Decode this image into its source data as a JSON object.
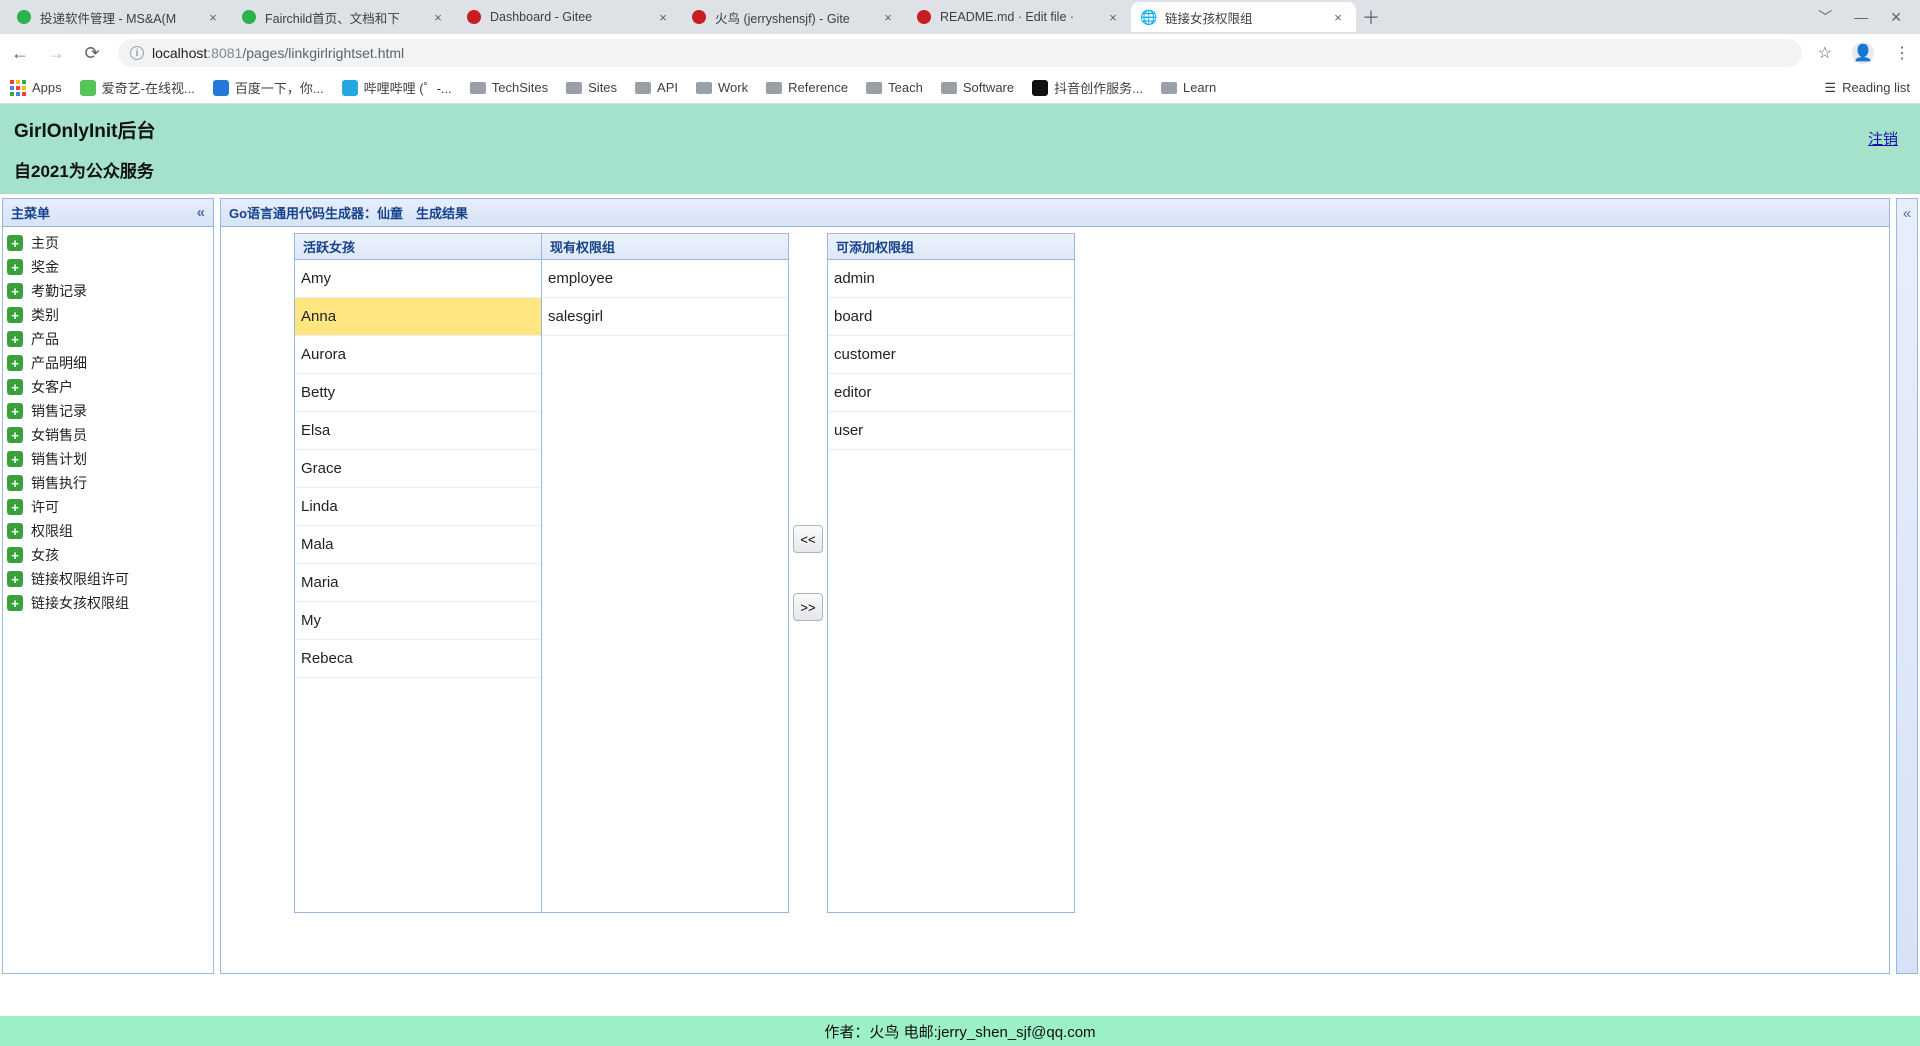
{
  "browser": {
    "tabs": [
      {
        "title": "投递软件管理 - MS&A(M",
        "favicon_color": "#2bb24c"
      },
      {
        "title": "Fairchild首页、文档和下",
        "favicon_color": "#2bb24c"
      },
      {
        "title": "Dashboard - Gitee",
        "favicon_color": "#c71d23"
      },
      {
        "title": "火鸟 (jerryshensjf) - Gite",
        "favicon_color": "#c71d23"
      },
      {
        "title": "README.md · Edit file · ",
        "favicon_color": "#c71d23"
      },
      {
        "title": "链接女孩权限组",
        "favicon_color": "#888888",
        "active": true
      }
    ],
    "url_host": "localhost",
    "url_port": ":8081",
    "url_path": "/pages/linkgirlrightset.html",
    "bookmarks": {
      "apps": "Apps",
      "items": [
        {
          "label": "爱奇艺-在线视...",
          "color": "#55c355"
        },
        {
          "label": "百度一下，你...",
          "color": "#2678d9"
        },
        {
          "label": "哔哩哔哩 (゜-...",
          "color": "#23a8e2"
        }
      ],
      "folders": [
        "TechSites",
        "Sites",
        "API",
        "Work",
        "Reference",
        "Teach",
        "Software"
      ],
      "after_folders": [
        {
          "label": "抖音创作服务...",
          "color": "#111"
        }
      ],
      "folders2": [
        "Learn"
      ],
      "reading_list": "Reading list"
    }
  },
  "page": {
    "title": "GirlOnlyInit后台",
    "subtitle": "自2021为公众服务",
    "logout": "注销",
    "footer": "作者：火鸟 电邮:jerry_shen_sjf@qq.com"
  },
  "sidebar": {
    "title": "主菜单",
    "items": [
      "主页",
      "奖金",
      "考勤记录",
      "类别",
      "产品",
      "产品明细",
      "女客户",
      "销售记录",
      "女销售员",
      "销售计划",
      "销售执行",
      "许可",
      "权限组",
      "女孩",
      "链接权限组许可",
      "链接女孩权限组"
    ]
  },
  "main": {
    "title": "Go语言通用代码生成器：仙童　生成结果",
    "girls_title": "活跃女孩",
    "girls": [
      "Amy",
      "Anna",
      "Aurora",
      "Betty",
      "Elsa",
      "Grace",
      "Linda",
      "Mala",
      "Maria",
      "My",
      "Rebeca"
    ],
    "girls_selected_index": 1,
    "current_title": "现有权限组",
    "current": [
      "employee",
      "salesgirl"
    ],
    "available_title": "可添加权限组",
    "available": [
      "admin",
      "board",
      "customer",
      "editor",
      "user"
    ],
    "btn_left": "<<",
    "btn_right": ">>"
  }
}
